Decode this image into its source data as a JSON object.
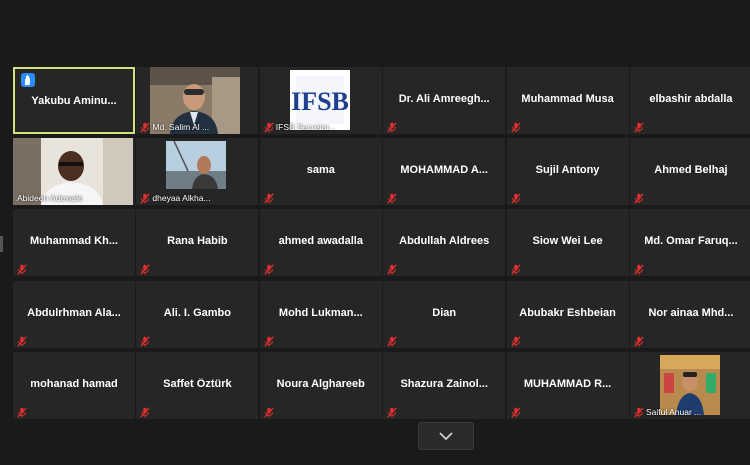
{
  "participants": [
    {
      "name": "Yakubu  Aminu...",
      "muted": false,
      "raised_hand": true,
      "active": true
    },
    {
      "name": "Md. Salim Al ...",
      "muted": true,
      "video": "man-suit"
    },
    {
      "name": "IFSB Secretar...",
      "muted": true,
      "video": "logo"
    },
    {
      "name": "Dr. Ali Amreegh...",
      "muted": true
    },
    {
      "name": "Muhammad Musa",
      "muted": true
    },
    {
      "name": "elbashir abdalla",
      "muted": true
    },
    {
      "name": "Abideen Adewale",
      "muted": false,
      "video": "man-glasses"
    },
    {
      "name": "dheyaa Alkha...",
      "muted": true,
      "video": "man-outdoor"
    },
    {
      "name": "sama",
      "muted": true
    },
    {
      "name": "MOHAMMAD  A...",
      "muted": true
    },
    {
      "name": "Sujil Antony",
      "muted": true
    },
    {
      "name": "Ahmed Belhaj",
      "muted": true
    },
    {
      "name": "Muhammad  Kh...",
      "muted": true
    },
    {
      "name": "Rana Habib",
      "muted": true
    },
    {
      "name": "ahmed awadalla",
      "muted": true
    },
    {
      "name": "Abdullah Aldrees",
      "muted": true
    },
    {
      "name": "Siow Wei Lee",
      "muted": true
    },
    {
      "name": "Md.  Omar  Faruq...",
      "muted": true
    },
    {
      "name": "Abdulrhman  Ala...",
      "muted": true
    },
    {
      "name": "Ali. I. Gambo",
      "muted": true
    },
    {
      "name": "Mohd  Lukman...",
      "muted": true
    },
    {
      "name": "Dian",
      "muted": true
    },
    {
      "name": "Abubakr Eshbeian",
      "muted": true
    },
    {
      "name": "Nor ainaa  Mhd...",
      "muted": true
    },
    {
      "name": "mohanad hamad",
      "muted": true
    },
    {
      "name": "Saffet Öztürk",
      "muted": true
    },
    {
      "name": "Noura Alghareeb",
      "muted": true
    },
    {
      "name": "Shazura  Zainol...",
      "muted": true
    },
    {
      "name": "MUHAMMAD  R...",
      "muted": true
    },
    {
      "name": "Saiful Anuar ...",
      "muted": true,
      "video": "man-shop"
    }
  ],
  "logo_text": "IFSB",
  "colors": {
    "active_border": "#d5e27a",
    "muted_icon": "#e02f2f",
    "hand": "#2d8cff",
    "tile": "#262626",
    "bg": "#1a1a1a"
  }
}
